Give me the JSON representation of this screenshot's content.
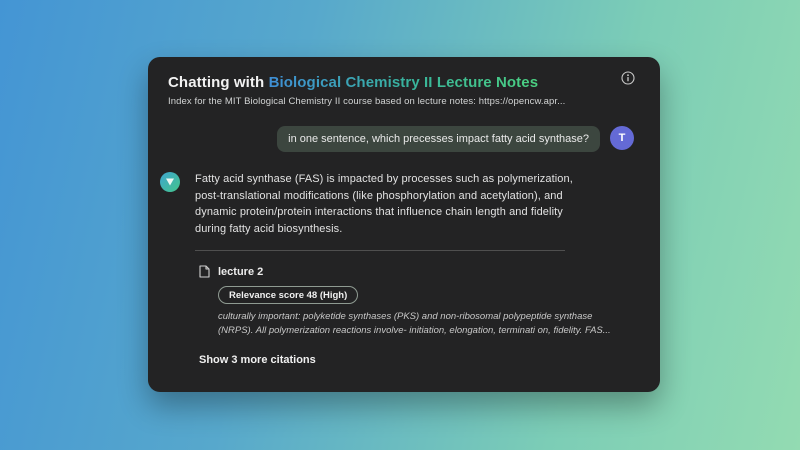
{
  "header": {
    "title_prefix": "Chatting with ",
    "title_highlight": "Biological Chemistry II Lecture Notes",
    "subtitle": "Index for the MIT Biological Chemistry II course based on lecture notes: https://opencw.apr...",
    "info_icon": "info-circle-icon"
  },
  "chat": {
    "user_message": {
      "text": "in one sentence, which precesses impact fatty acid synthase?",
      "avatar_label": "T",
      "avatar_color": "#646ad6"
    },
    "assistant_message": {
      "avatar_icon": "funnel-triangle-icon",
      "text": "Fatty acid synthase (FAS) is impacted by processes such as polymerization, post-translational modifications (like phosphorylation and acetylation), and dynamic protein/protein interactions that influence chain length and fidelity during fatty acid biosynthesis."
    },
    "citation": {
      "source": "lecture 2",
      "source_icon": "document-icon",
      "relevance_badge": "Relevance score 48 (High)",
      "snippet": "culturally important: polyketide synthases (PKS) and non-ribosomal polypeptide synthase (NRPS). All polymerization reactions involve- initiation, elongation, terminati on, fidelity. FAS...",
      "show_more": "Show 3 more citations"
    }
  },
  "colors": {
    "background_gradient_left": "#4495d4",
    "background_gradient_right": "#93dbb2",
    "card_background": "#232324",
    "title_gradient_start": "#3f8fd6",
    "title_gradient_end": "#4bd181",
    "user_bubble": "#3c463f",
    "user_avatar": "#646ad6",
    "assistant_avatar_gradient_start": "#3fa6d0",
    "assistant_avatar_gradient_end": "#43c48a"
  }
}
